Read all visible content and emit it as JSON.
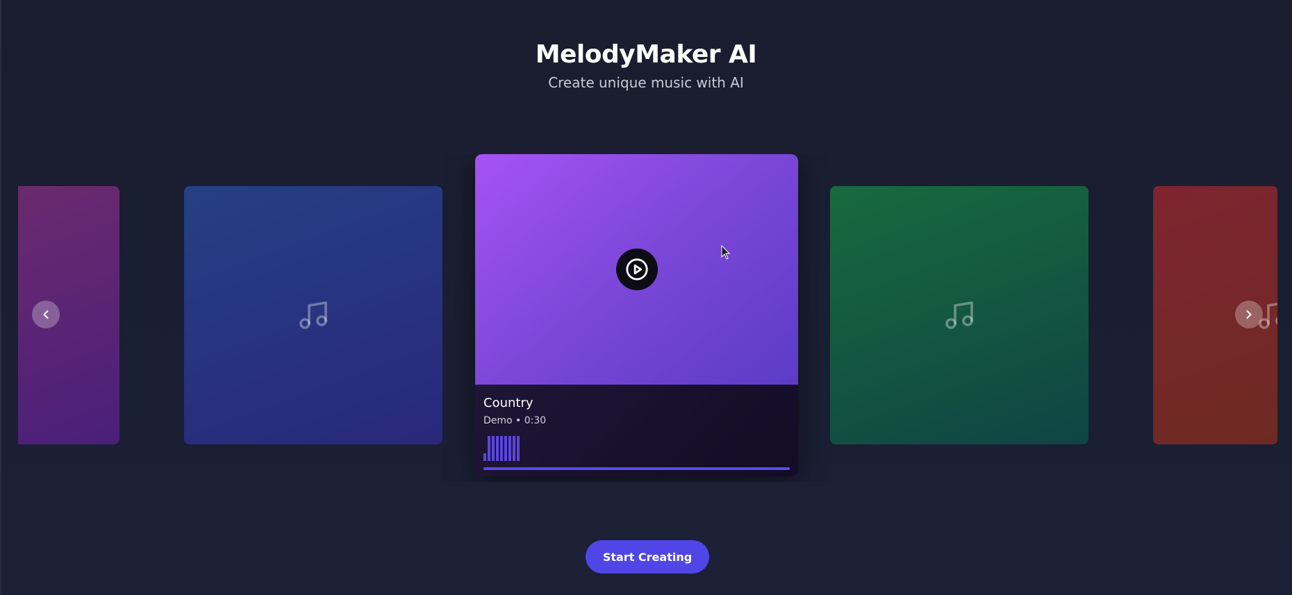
{
  "header": {
    "title": "MelodyMaker AI",
    "subtitle": "Create unique music with AI"
  },
  "carousel": {
    "cards": [
      {
        "theme": "purple",
        "colors": [
          "#6b2a6e",
          "#4a1f7a"
        ],
        "icon": "music-note-icon"
      },
      {
        "theme": "blue",
        "colors": [
          "#253f84",
          "#29287a"
        ],
        "icon": "music-note-icon"
      },
      {
        "theme": "violet",
        "colors": [
          "#a653f4",
          "#5b3cc6"
        ],
        "icon": "play-icon",
        "active": true
      },
      {
        "theme": "green",
        "colors": [
          "#186a3e",
          "#0f4444"
        ],
        "icon": "music-note-icon"
      },
      {
        "theme": "red",
        "colors": [
          "#7e2530",
          "#6e2a22"
        ],
        "icon": "music-note-icon"
      }
    ],
    "active_song": {
      "title": "Country",
      "meta": "Demo • 0:30",
      "progress_fraction": 1.0,
      "waveform_levels": [
        0.25,
        0.85,
        0.85,
        0.85,
        0.85,
        0.85,
        0.85,
        0.85,
        0.85
      ]
    },
    "prev_icon": "chevron-left-icon",
    "next_icon": "chevron-right-icon"
  },
  "cta": {
    "label": "Start Creating"
  },
  "colors": {
    "accent": "#4f46e5",
    "background": "#1a1d2e"
  }
}
